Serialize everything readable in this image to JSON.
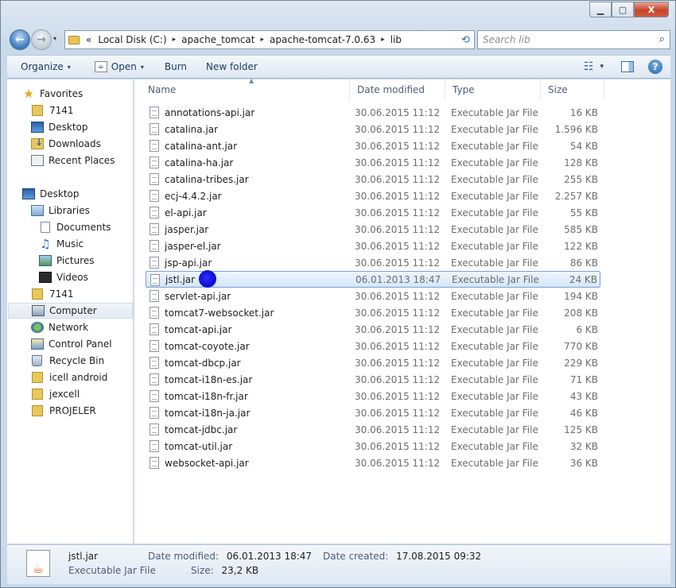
{
  "window": {
    "caption_buttons": {
      "minimize": "▁",
      "maximize": "▢",
      "close": "X"
    }
  },
  "nav": {
    "back_icon": "←",
    "forward_icon": "→",
    "history_dropdown": "▾",
    "address_prefix": "«",
    "breadcrumbs": [
      "Local Disk (C:)",
      "apache_tomcat",
      "apache-tomcat-7.0.63",
      "lib"
    ],
    "breadcrumb_sep": "▸",
    "address_dropdown": "▾",
    "refresh_icon": "⟲",
    "search_placeholder": "Search lib",
    "search_icon": "⌕"
  },
  "toolbar": {
    "organize": "Organize",
    "open": "Open",
    "burn": "Burn",
    "new_folder": "New folder",
    "dropdown": "▾",
    "views_icon": "☷",
    "help": "?"
  },
  "sidebar": {
    "items": [
      {
        "label": "Favorites",
        "icon": "star-icon"
      },
      {
        "label": "7141",
        "icon": "folder-icon"
      },
      {
        "label": "Desktop",
        "icon": "desktop-icon"
      },
      {
        "label": "Downloads",
        "icon": "downloads-icon"
      },
      {
        "label": "Recent Places",
        "icon": "recent-places-icon"
      },
      {
        "label": "Desktop",
        "icon": "desktop-icon"
      },
      {
        "label": "Libraries",
        "icon": "libraries-icon"
      },
      {
        "label": "Documents",
        "icon": "documents-icon"
      },
      {
        "label": "Music",
        "icon": "music-icon"
      },
      {
        "label": "Pictures",
        "icon": "pictures-icon"
      },
      {
        "label": "Videos",
        "icon": "videos-icon"
      },
      {
        "label": "7141",
        "icon": "folder-icon"
      },
      {
        "label": "Computer",
        "icon": "computer-icon"
      },
      {
        "label": "Network",
        "icon": "network-icon"
      },
      {
        "label": "Control Panel",
        "icon": "control-panel-icon"
      },
      {
        "label": "Recycle Bin",
        "icon": "recycle-bin-icon"
      },
      {
        "label": "icell android",
        "icon": "folder-icon"
      },
      {
        "label": "jexcell",
        "icon": "folder-icon"
      },
      {
        "label": "PROJELER",
        "icon": "folder-icon"
      }
    ]
  },
  "columns": {
    "name": "Name",
    "date": "Date modified",
    "type": "Type",
    "size": "Size",
    "sort_indicator": "▲"
  },
  "files": [
    {
      "name": "annotations-api.jar",
      "date": "30.06.2015 11:12",
      "type": "Executable Jar File",
      "size": "16 KB"
    },
    {
      "name": "catalina.jar",
      "date": "30.06.2015 11:12",
      "type": "Executable Jar File",
      "size": "1.596 KB"
    },
    {
      "name": "catalina-ant.jar",
      "date": "30.06.2015 11:12",
      "type": "Executable Jar File",
      "size": "54 KB"
    },
    {
      "name": "catalina-ha.jar",
      "date": "30.06.2015 11:12",
      "type": "Executable Jar File",
      "size": "128 KB"
    },
    {
      "name": "catalina-tribes.jar",
      "date": "30.06.2015 11:12",
      "type": "Executable Jar File",
      "size": "255 KB"
    },
    {
      "name": "ecj-4.4.2.jar",
      "date": "30.06.2015 11:12",
      "type": "Executable Jar File",
      "size": "2.257 KB"
    },
    {
      "name": "el-api.jar",
      "date": "30.06.2015 11:12",
      "type": "Executable Jar File",
      "size": "55 KB"
    },
    {
      "name": "jasper.jar",
      "date": "30.06.2015 11:12",
      "type": "Executable Jar File",
      "size": "585 KB"
    },
    {
      "name": "jasper-el.jar",
      "date": "30.06.2015 11:12",
      "type": "Executable Jar File",
      "size": "122 KB"
    },
    {
      "name": "jsp-api.jar",
      "date": "30.06.2015 11:12",
      "type": "Executable Jar File",
      "size": "86 KB"
    },
    {
      "name": "jstl.jar",
      "date": "06.01.2013 18:47",
      "type": "Executable Jar File",
      "size": "24 KB",
      "selected": true
    },
    {
      "name": "servlet-api.jar",
      "date": "30.06.2015 11:12",
      "type": "Executable Jar File",
      "size": "194 KB"
    },
    {
      "name": "tomcat7-websocket.jar",
      "date": "30.06.2015 11:12",
      "type": "Executable Jar File",
      "size": "208 KB"
    },
    {
      "name": "tomcat-api.jar",
      "date": "30.06.2015 11:12",
      "type": "Executable Jar File",
      "size": "6 KB"
    },
    {
      "name": "tomcat-coyote.jar",
      "date": "30.06.2015 11:12",
      "type": "Executable Jar File",
      "size": "770 KB"
    },
    {
      "name": "tomcat-dbcp.jar",
      "date": "30.06.2015 11:12",
      "type": "Executable Jar File",
      "size": "229 KB"
    },
    {
      "name": "tomcat-i18n-es.jar",
      "date": "30.06.2015 11:12",
      "type": "Executable Jar File",
      "size": "71 KB"
    },
    {
      "name": "tomcat-i18n-fr.jar",
      "date": "30.06.2015 11:12",
      "type": "Executable Jar File",
      "size": "43 KB"
    },
    {
      "name": "tomcat-i18n-ja.jar",
      "date": "30.06.2015 11:12",
      "type": "Executable Jar File",
      "size": "46 KB"
    },
    {
      "name": "tomcat-jdbc.jar",
      "date": "30.06.2015 11:12",
      "type": "Executable Jar File",
      "size": "125 KB"
    },
    {
      "name": "tomcat-util.jar",
      "date": "30.06.2015 11:12",
      "type": "Executable Jar File",
      "size": "32 KB"
    },
    {
      "name": "websocket-api.jar",
      "date": "30.06.2015 11:12",
      "type": "Executable Jar File",
      "size": "36 KB"
    }
  ],
  "details": {
    "name": "jstl.jar",
    "type": "Executable Jar File",
    "modified_label": "Date modified:",
    "modified_value": "06.01.2013 18:47",
    "size_label": "Size:",
    "size_value": "23,2 KB",
    "created_label": "Date created:",
    "created_value": "17.08.2015 09:32"
  },
  "colors": {
    "selection": "#d5e6f8",
    "selection_border": "#7da2ce",
    "annotation_blob": "#0c0fd8"
  }
}
